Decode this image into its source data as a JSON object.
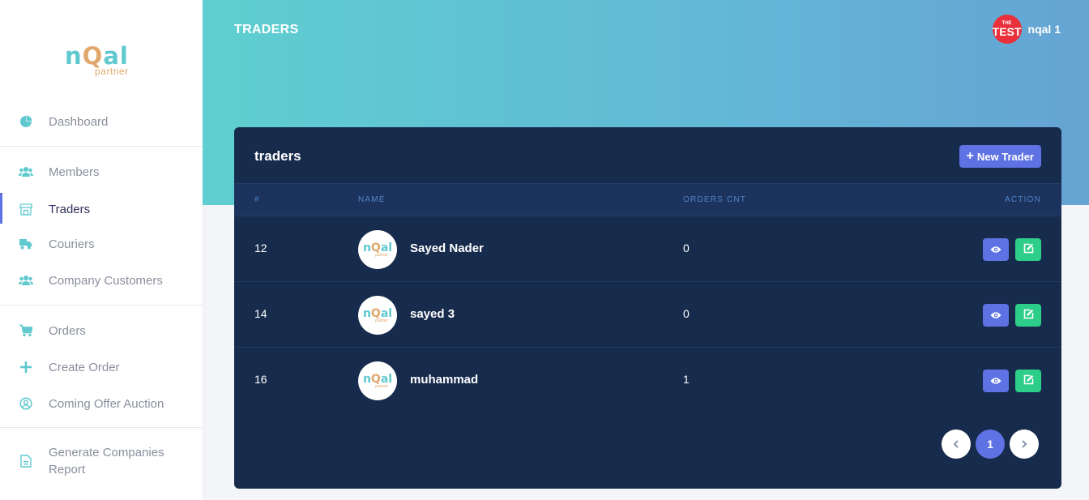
{
  "brand": {
    "word_start": "n",
    "word_mid": "Q",
    "word_end": "al",
    "sub": "partner"
  },
  "sidebar": {
    "items": [
      {
        "label": "Dashboard",
        "icon": "pie-chart-icon"
      },
      {
        "label": "Members",
        "icon": "users-icon"
      },
      {
        "label": "Traders",
        "icon": "store-icon",
        "active": true
      },
      {
        "label": "Couriers",
        "icon": "truck-icon"
      },
      {
        "label": "Company Customers",
        "icon": "users-icon"
      },
      {
        "label": "Orders",
        "icon": "cart-icon"
      },
      {
        "label": "Create Order",
        "icon": "plus-icon"
      },
      {
        "label": "Coming Offer Auction",
        "icon": "user-circle-icon"
      },
      {
        "label_line1": "Generate Companies",
        "label_line2": "Report",
        "icon": "document-icon"
      }
    ]
  },
  "header": {
    "title": "TRADERS",
    "user": {
      "avatar_top": "THE",
      "avatar_main": "TEST",
      "name": "nqal 1"
    }
  },
  "card": {
    "title": "traders",
    "new_button": "New Trader",
    "columns": [
      "#",
      "NAME",
      "ORDERS CNT",
      "ACTION"
    ],
    "rows": [
      {
        "id": "12",
        "name": "Sayed Nader",
        "orders": "0"
      },
      {
        "id": "14",
        "name": "sayed 3",
        "orders": "0"
      },
      {
        "id": "16",
        "name": "muhammad",
        "orders": "1"
      }
    ],
    "pagination": {
      "current": "1"
    }
  },
  "colors": {
    "accent": "#5e72e4",
    "success": "#2dce89",
    "teal": "#5fc9cf",
    "card_bg": "#172b4d"
  }
}
